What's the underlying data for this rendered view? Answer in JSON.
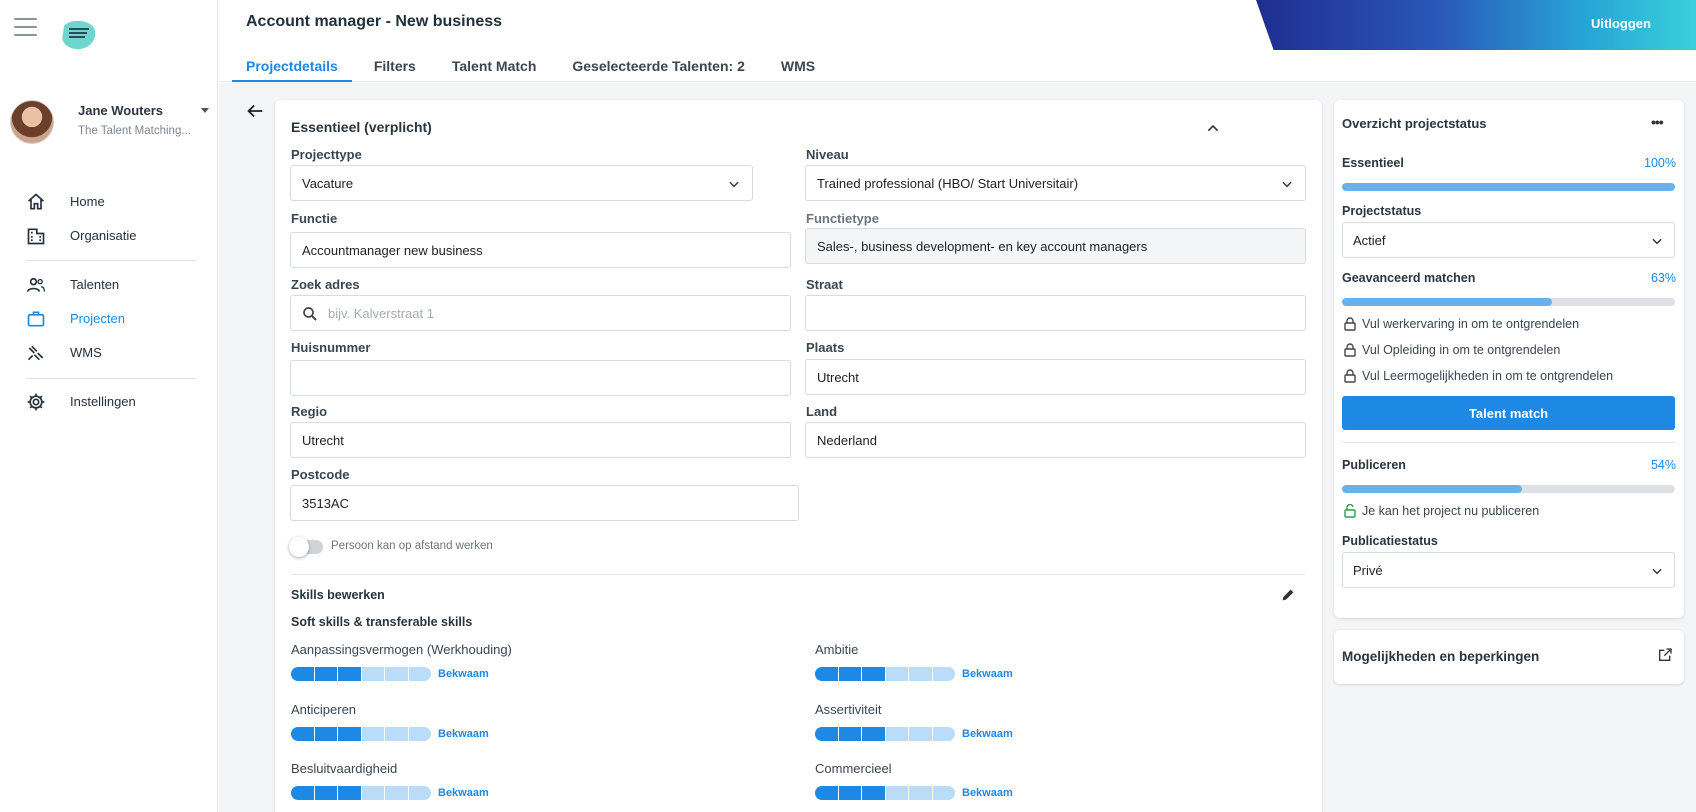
{
  "header": {
    "title": "Account manager - New business",
    "logout_label": "Uitloggen",
    "tabs": [
      {
        "label": "Projectdetails",
        "active": true
      },
      {
        "label": "Filters",
        "active": false
      },
      {
        "label": "Talent Match",
        "active": false
      },
      {
        "label": "Geselecteerde Talenten: 2",
        "active": false
      },
      {
        "label": "WMS",
        "active": false
      }
    ]
  },
  "sidebar": {
    "user": {
      "name": "Jane Wouters",
      "organization": "The Talent Matching..."
    },
    "items": [
      {
        "label": "Home",
        "icon": "home-icon"
      },
      {
        "label": "Organisatie",
        "icon": "building-icon"
      },
      {
        "label": "Talenten",
        "icon": "people-icon"
      },
      {
        "label": "Projecten",
        "icon": "briefcase-icon",
        "active": true
      },
      {
        "label": "WMS",
        "icon": "wms-icon"
      },
      {
        "label": "Instellingen",
        "icon": "gear-icon"
      }
    ]
  },
  "essentials": {
    "title": "Essentieel (verplicht)",
    "projecttype": {
      "label": "Projecttype",
      "value": "Vacature"
    },
    "niveau": {
      "label": "Niveau",
      "value": "Trained professional (HBO/ Start Universitair)"
    },
    "functie": {
      "label": "Functie",
      "value": "Accountmanager new business"
    },
    "functietype": {
      "label": "Functietype",
      "value": "Sales-, business development- en key account managers"
    },
    "zoek_adres": {
      "label": "Zoek adres",
      "placeholder": "bijv. Kalverstraat 1"
    },
    "straat": {
      "label": "Straat",
      "value": ""
    },
    "huisnummer": {
      "label": "Huisnummer",
      "value": ""
    },
    "plaats": {
      "label": "Plaats",
      "value": "Utrecht"
    },
    "regio": {
      "label": "Regio",
      "value": "Utrecht"
    },
    "land": {
      "label": "Land",
      "value": "Nederland"
    },
    "postcode": {
      "label": "Postcode",
      "value": "3513AC"
    },
    "remote_toggle": {
      "label": "Persoon kan op afstand werken",
      "on": false
    }
  },
  "skills": {
    "title": "Skills bewerken",
    "subtitle": "Soft skills & transferable skills",
    "items": [
      {
        "name": "Aanpassingsvermogen (Werkhouding)",
        "level": "Bekwaam",
        "filled": 3,
        "total": 6
      },
      {
        "name": "Ambitie",
        "level": "Bekwaam",
        "filled": 3,
        "total": 6
      },
      {
        "name": "Anticiperen",
        "level": "Bekwaam",
        "filled": 3,
        "total": 6
      },
      {
        "name": "Assertiviteit",
        "level": "Bekwaam",
        "filled": 3,
        "total": 6
      },
      {
        "name": "Besluitvaardigheid",
        "level": "Bekwaam",
        "filled": 3,
        "total": 6
      },
      {
        "name": "Commercieel",
        "level": "Bekwaam",
        "filled": 3,
        "total": 6
      }
    ]
  },
  "status_panel": {
    "title": "Overzicht projectstatus",
    "essentieel": {
      "label": "Essentieel",
      "percent": "100%",
      "value": 1.0
    },
    "projectstatus": {
      "label": "Projectstatus",
      "value": "Actief"
    },
    "geavanceerd": {
      "label": "Geavanceerd matchen",
      "percent": "63%",
      "value": 0.63
    },
    "locks": [
      "Vul werkervaring in om te ontgrendelen",
      "Vul Opleiding in om te ontgrendelen",
      "Vul Leermogelijkheden in om te ontgrendelen"
    ],
    "talent_match_button": "Talent match",
    "publiceren": {
      "label": "Publiceren",
      "percent": "54%",
      "value": 0.54
    },
    "publish_note": "Je kan het project nu publiceren",
    "publicatiestatus": {
      "label": "Publicatiestatus",
      "value": "Privé"
    }
  },
  "limits_panel": {
    "title": "Mogelijkheden en beperkingen"
  },
  "colors": {
    "accent": "#1e88e5",
    "progress": "#69b1ec",
    "lock_ok": "#2e9d4f"
  }
}
